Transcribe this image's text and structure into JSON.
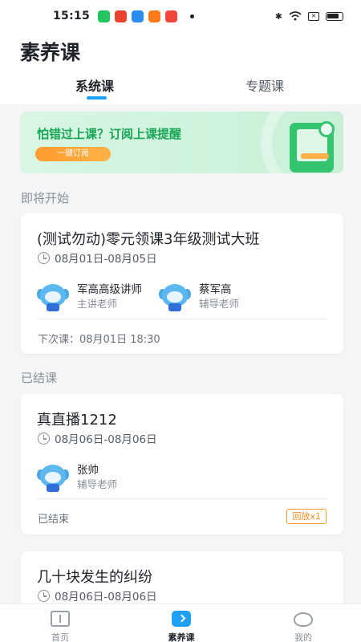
{
  "status_bar": {
    "time": "15:15",
    "app_icons": [
      {
        "name": "app-green-icon",
        "color": "#22c55e"
      },
      {
        "name": "weibo-icon",
        "color": "#e8432f"
      },
      {
        "name": "app-blue-icon",
        "color": "#2b8cf0"
      },
      {
        "name": "app-orange-icon",
        "color": "#ff7a1a"
      },
      {
        "name": "video-app-icon",
        "color": "#f2453d"
      }
    ]
  },
  "header": {
    "title": "素养课",
    "tabs": [
      {
        "label": "系统课",
        "active": true
      },
      {
        "label": "专题课",
        "active": false
      }
    ]
  },
  "banner": {
    "text": "怕错过上课？订阅上课提醒",
    "button": "一键订阅"
  },
  "sections": {
    "upcoming_label": "即将开始",
    "finished_label": "已结课"
  },
  "courses": [
    {
      "title": "(测试勿动)零元领课3年级测试大班",
      "date_range": "08月01日-08月05日",
      "teachers": [
        {
          "name": "军高高级讲师",
          "role": "主讲老师"
        },
        {
          "name": "蔡军高",
          "role": "辅导老师"
        }
      ],
      "footer": "下次课：08月01日 18:30"
    },
    {
      "title": "真直播1212",
      "date_range": "08月06日-08月06日",
      "teachers": [
        {
          "name": "张帅",
          "role": "辅导老师"
        }
      ],
      "footer": "已结束",
      "badge": "回放x1"
    },
    {
      "title": "几十块发生的纠纷",
      "date_range": "08月06日-08月06日"
    }
  ],
  "bottom_nav": [
    {
      "label": "首页",
      "icon": "book-icon",
      "active": false
    },
    {
      "label": "素养课",
      "icon": "play-icon",
      "active": true
    },
    {
      "label": "我的",
      "icon": "profile-icon",
      "active": false
    }
  ],
  "colors": {
    "accent": "#1ea0f5",
    "banner_green": "#18a657",
    "badge_orange": "#ff8a1f"
  }
}
